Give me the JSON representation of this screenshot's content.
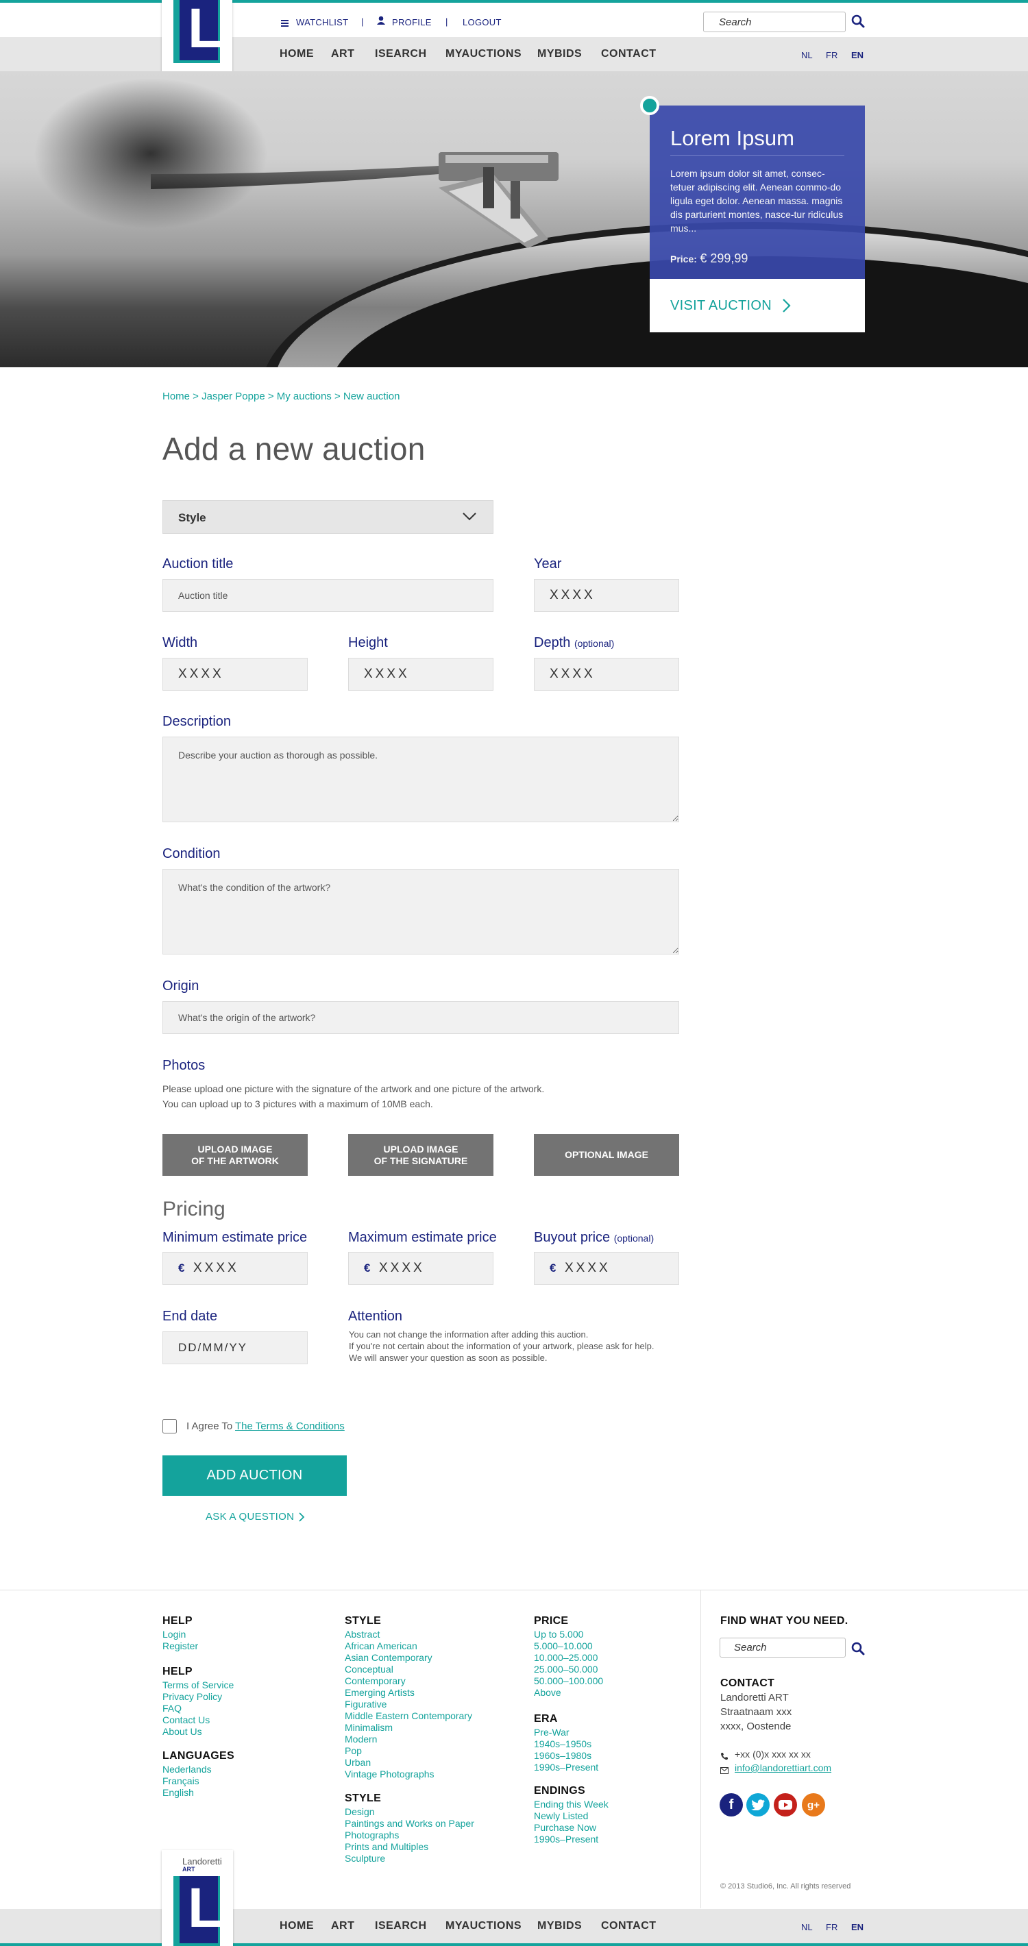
{
  "util": {
    "watchlist": "WATCHLIST",
    "profile": "PROFILE",
    "logout": "LOGOUT",
    "sep": "|"
  },
  "search": {
    "placeholder": "Search"
  },
  "nav": [
    "HOME",
    "ART",
    "ISEARCH",
    "MYAUCTIONS",
    "MYBIDS",
    "CONTACT"
  ],
  "langs": [
    "NL",
    "FR",
    "EN"
  ],
  "logo": {
    "name": "Landoretti",
    "sub": "ART",
    "letter": "L"
  },
  "hero": {
    "title": "Lorem Ipsum",
    "text": "Lorem ipsum dolor sit amet, consec-tetuer adipiscing elit. Aenean commo-do ligula eget dolor. Aenean massa. magnis dis parturient montes, nasce-tur ridiculus mus...",
    "price_label": "Price:",
    "price": "€ 299,99",
    "cta": "VISIT AUCTION"
  },
  "breadcrumb": "Home > Jasper Poppe > My auctions > New auction",
  "page_title": "Add a new auction",
  "form": {
    "style_label": "Style",
    "auction_title_label": "Auction title",
    "auction_title_placeholder": "Auction title",
    "year_label": "Year",
    "xxxx": "XXXX",
    "width_label": "Width",
    "height_label": "Height",
    "depth_label": "Depth",
    "optional": "(optional)",
    "description_label": "Description",
    "description_placeholder": "Describe your auction as thorough as possible.",
    "condition_label": "Condition",
    "condition_placeholder": "What's the condition of the artwork?",
    "origin_label": "Origin",
    "origin_placeholder": "What's the origin of the artwork?",
    "photos_label": "Photos",
    "photos_text_1": "Please upload one picture with the signature of the artwork and one picture of the artwork.",
    "photos_text_2": "You can upload up to 3 pictures with a maximum of 10MB each.",
    "upload_artwork_1": "UPLOAD IMAGE",
    "upload_artwork_2": "OF THE ARTWORK",
    "upload_signature_1": "UPLOAD IMAGE",
    "upload_signature_2": "OF THE SIGNATURE",
    "optional_image": "OPTIONAL IMAGE",
    "pricing_label": "Pricing",
    "min_price_label": "Minimum estimate price",
    "max_price_label": "Maximum estimate price",
    "buyout_label": "Buyout price",
    "euro": "€",
    "end_date_label": "End date",
    "end_date_placeholder": "DD/MM/YY",
    "attention_label": "Attention",
    "attention_1": "You can not change the information after adding this auction.",
    "attention_2": "If you're not certain about the information of your artwork, please ask for help.",
    "attention_3": "We will answer your question as soon as possible.",
    "agree_text": "I Agree To",
    "terms_link": "The Terms & Conditions",
    "submit": "ADD AUCTION",
    "ask": "ASK A QUESTION"
  },
  "footer": {
    "help1": {
      "title": "HELP",
      "links": [
        "Login",
        "Register"
      ]
    },
    "help2": {
      "title": "HELP",
      "links": [
        "Terms of Service",
        "Privacy Policy",
        "FAQ",
        "Contact Us",
        "About Us"
      ]
    },
    "languages": {
      "title": "LANGUAGES",
      "links": [
        "Nederlands",
        "Français",
        "English"
      ]
    },
    "style1": {
      "title": "STYLE",
      "links": [
        "Abstract",
        "African American",
        "Asian Contemporary",
        "Conceptual",
        "Contemporary",
        "Emerging Artists",
        "Figurative",
        "Middle Eastern Contemporary",
        "Minimalism",
        "Modern",
        "Pop",
        "Urban",
        "Vintage Photographs"
      ]
    },
    "style2": {
      "title": "STYLE",
      "links": [
        "Design",
        "Paintings and Works on Paper",
        "Photographs",
        "Prints and Multiples",
        "Sculpture"
      ]
    },
    "price": {
      "title": "PRICE",
      "links": [
        "Up to 5.000",
        "5.000–10.000",
        "10.000–25.000",
        "25.000–50.000",
        "50.000–100.000",
        "Above"
      ]
    },
    "era": {
      "title": "ERA",
      "links": [
        "Pre-War",
        "1940s–1950s",
        "1960s–1980s",
        "1990s–Present"
      ]
    },
    "endings": {
      "title": "ENDINGS",
      "links": [
        "Ending this Week",
        "Newly Listed",
        "Purchase Now",
        "1990s–Present"
      ]
    },
    "find_title": "FIND WHAT YOU NEED.",
    "contact_title": "CONTACT",
    "address": [
      "Landoretti ART",
      "Straatnaam xxx",
      "xxxx, Oostende"
    ],
    "phone": "+xx (0)x xxx xx xx",
    "email": "info@landorettiart.com",
    "copyright": "© 2013 Studio6, Inc. All rights reserved"
  },
  "colors": {
    "accent": "#14a39c",
    "navy": "#1a237e",
    "hero_card": "#3949ab",
    "button_grey": "#737373"
  }
}
